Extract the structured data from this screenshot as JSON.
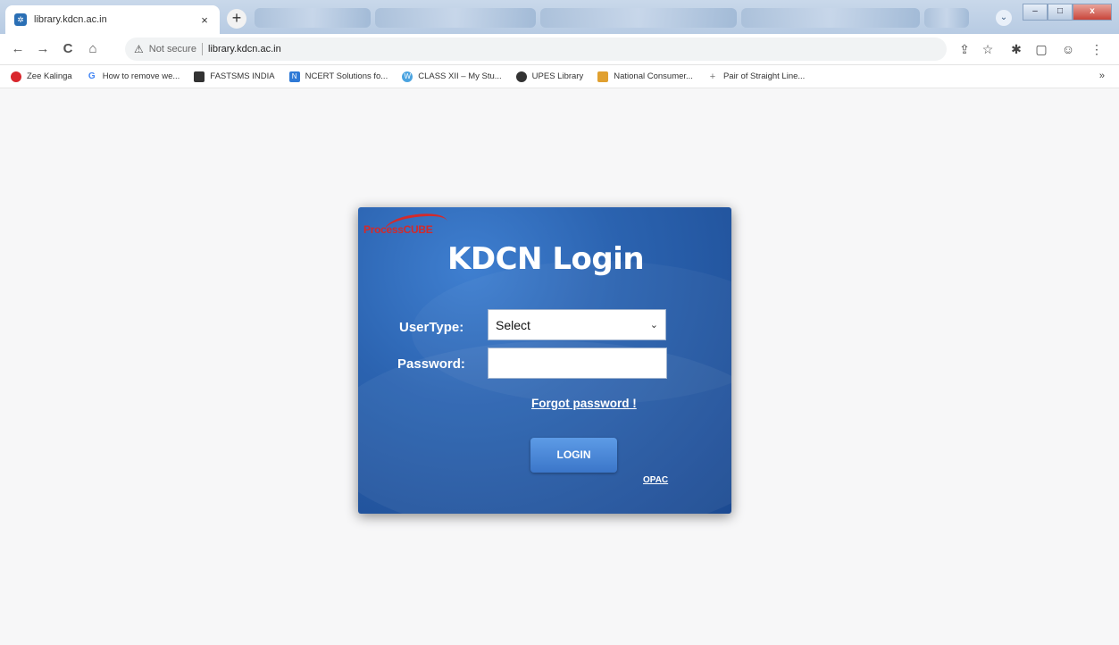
{
  "browser": {
    "tab_title": "library.kdcn.ac.in",
    "tab_close": "×",
    "new_tab": "+",
    "nav": {
      "back": "←",
      "forward": "→",
      "reload": "C",
      "home": "⌂"
    },
    "security_warning": "Not secure",
    "url": "library.kdcn.ac.in",
    "window_buttons": {
      "minimize": "–",
      "maximize": "□",
      "close": "x"
    }
  },
  "bookmarks": [
    {
      "label": "Zee Kalinga",
      "color": "#d9262c",
      "glyph": "●"
    },
    {
      "label": "How to remove we...",
      "color": "#ffffff",
      "glyph": "G"
    },
    {
      "label": "FASTSMS INDIA",
      "color": "#333333",
      "glyph": "✉"
    },
    {
      "label": "NCERT Solutions fo...",
      "color": "#2f7ad6",
      "glyph": "N"
    },
    {
      "label": "CLASS XII – My Stu...",
      "color": "#4aa3e0",
      "glyph": "W"
    },
    {
      "label": "UPES Library",
      "color": "#333333",
      "glyph": "◉"
    },
    {
      "label": "National Consumer...",
      "color": "#e0a030",
      "glyph": "▮"
    },
    {
      "label": "Pair of Straight Line...",
      "color": "#888888",
      "glyph": "+"
    }
  ],
  "bookmarks_more": "»",
  "login": {
    "brand": "ProcessCUBE",
    "title": "KDCN Login",
    "usertype_label": "UserType:",
    "usertype_value": "Select",
    "password_label": "Password:",
    "password_value": "",
    "forgot": "Forgot password !",
    "button": "LOGIN",
    "opac": "OPAC"
  }
}
